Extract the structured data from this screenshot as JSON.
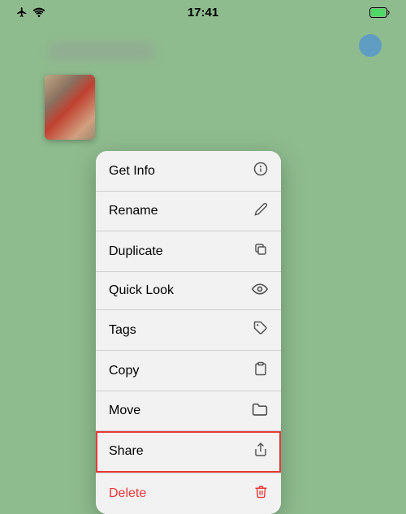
{
  "statusBar": {
    "time": "17:41",
    "icons": {
      "airplane": "✈",
      "wifi": "wifi-icon",
      "battery": "battery-icon"
    }
  },
  "menu": {
    "items": [
      {
        "id": "get-info",
        "label": "Get Info",
        "icon": "ℹ"
      },
      {
        "id": "rename",
        "label": "Rename",
        "icon": "✏"
      },
      {
        "id": "duplicate",
        "label": "Duplicate",
        "icon": "⧉"
      },
      {
        "id": "quick-look",
        "label": "Quick Look",
        "icon": "👁"
      },
      {
        "id": "tags",
        "label": "Tags",
        "icon": "🏷"
      },
      {
        "id": "copy",
        "label": "Copy",
        "icon": "📋"
      },
      {
        "id": "move",
        "label": "Move",
        "icon": "📁"
      },
      {
        "id": "share",
        "label": "Share",
        "icon": "share",
        "highlighted": true
      },
      {
        "id": "delete",
        "label": "Delete",
        "icon": "🗑",
        "danger": true
      }
    ]
  }
}
